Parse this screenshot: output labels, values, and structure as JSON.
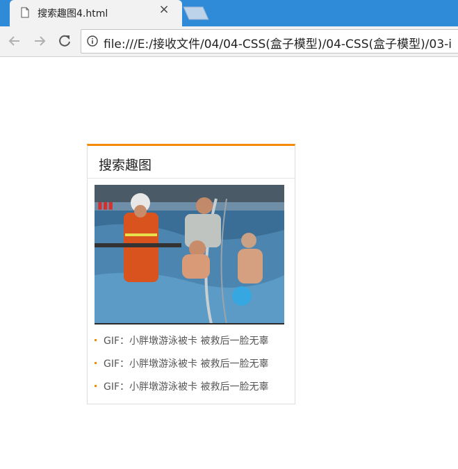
{
  "browser": {
    "tab_title": "搜索趣图4.html",
    "close_symbol": "×",
    "url": "file:///E:/接收文件/04/04-CSS(盒子模型)/04-CSS(盒子模型)/03-i"
  },
  "widget": {
    "title": "搜索趣图",
    "items": [
      {
        "text": "GIF：小胖墩游泳被卡 被救后一脸无辜"
      },
      {
        "text": "GIF：小胖墩游泳被卡 被救后一脸无辜"
      },
      {
        "text": "GIF：小胖墩游泳被卡 被救后一脸无辜"
      }
    ]
  },
  "colors": {
    "accent": "#f48a00",
    "tabbar": "#2f8ad8",
    "pool_water": "#3a6e96"
  }
}
